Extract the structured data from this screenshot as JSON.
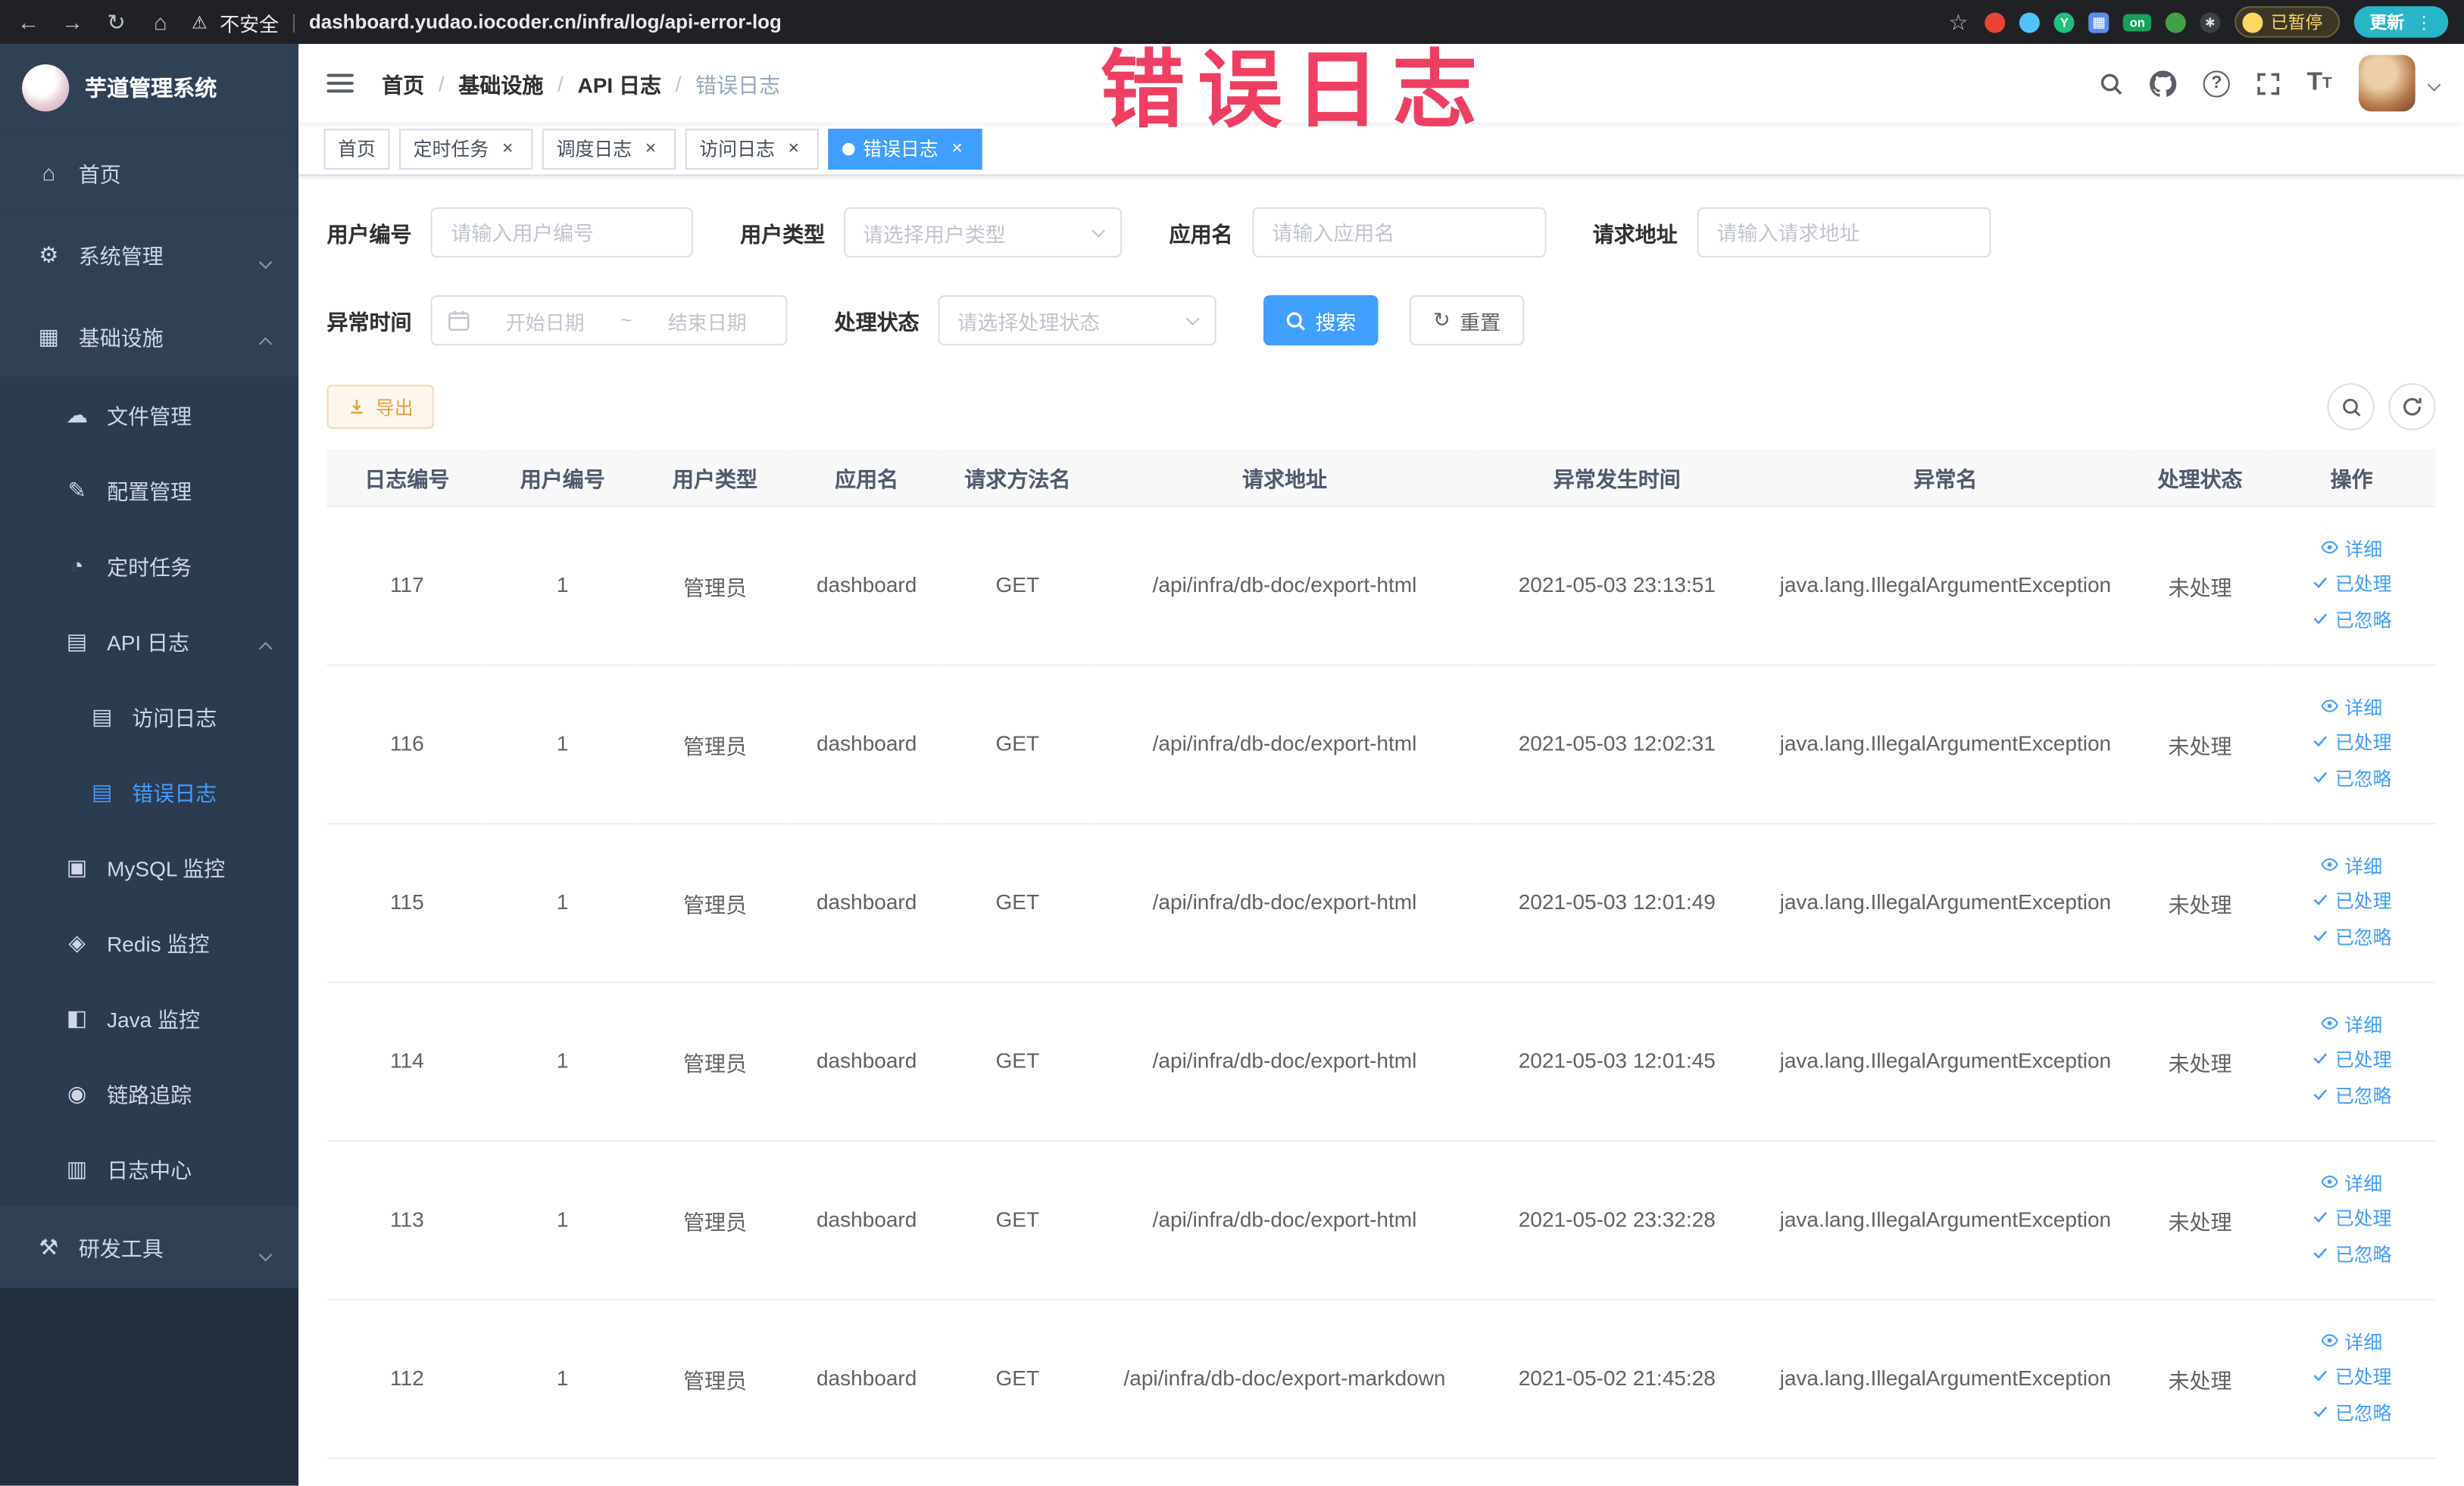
{
  "browser": {
    "insecure_label": "不安全",
    "url": "dashboard.yudao.iocoder.cn/infra/log/api-error-log",
    "extension_badge": "on",
    "extension_letter": "Y",
    "paused_button": "已暂停",
    "update_button": "更新"
  },
  "annotation": "错误日志",
  "sidebar": {
    "logo_title": "芋道管理系统",
    "items": [
      {
        "id": "home",
        "label": "首页",
        "icon": "home-icon",
        "level": 1
      },
      {
        "id": "system",
        "label": "系统管理",
        "icon": "gear-icon",
        "level": 1,
        "arrow": "down"
      },
      {
        "id": "infra",
        "label": "基础设施",
        "icon": "grid-icon",
        "level": 1,
        "arrow": "up"
      },
      {
        "id": "file",
        "label": "文件管理",
        "icon": "cloud-icon",
        "level": 2
      },
      {
        "id": "config",
        "label": "配置管理",
        "icon": "edit-icon",
        "level": 2
      },
      {
        "id": "job",
        "label": "定时任务",
        "icon": "clock-icon",
        "level": 2
      },
      {
        "id": "api-log",
        "label": "API 日志",
        "icon": "document-icon",
        "level": 2,
        "arrow": "up"
      },
      {
        "id": "access-log",
        "label": "访问日志",
        "icon": "document-icon",
        "level": 3
      },
      {
        "id": "error-log",
        "label": "错误日志",
        "icon": "document-icon",
        "level": 3,
        "active": true
      },
      {
        "id": "mysql",
        "label": "MySQL 监控",
        "icon": "database-icon",
        "level": 2
      },
      {
        "id": "redis",
        "label": "Redis 监控",
        "icon": "redis-icon",
        "level": 2
      },
      {
        "id": "java",
        "label": "Java 监控",
        "icon": "monitor-icon",
        "level": 2
      },
      {
        "id": "trace",
        "label": "链路追踪",
        "icon": "eye-icon",
        "level": 2
      },
      {
        "id": "log-center",
        "label": "日志中心",
        "icon": "log-icon",
        "level": 2
      },
      {
        "id": "devtools",
        "label": "研发工具",
        "icon": "tools-icon",
        "level": 1,
        "arrow": "down"
      }
    ]
  },
  "navbar": {
    "breadcrumb": [
      "首页",
      "基础设施",
      "API 日志",
      "错误日志"
    ]
  },
  "tabs": [
    {
      "id": "home",
      "label": "首页",
      "closable": false,
      "active": false
    },
    {
      "id": "cron-job",
      "label": "定时任务",
      "closable": true,
      "active": false
    },
    {
      "id": "job-log",
      "label": "调度日志",
      "closable": true,
      "active": false
    },
    {
      "id": "access-log",
      "label": "访问日志",
      "closable": true,
      "active": false
    },
    {
      "id": "error-log",
      "label": "错误日志",
      "closable": true,
      "active": true
    }
  ],
  "filters": {
    "user_id_label": "用户编号",
    "user_id_placeholder": "请输入用户编号",
    "user_type_label": "用户类型",
    "user_type_placeholder": "请选择用户类型",
    "app_name_label": "应用名",
    "app_name_placeholder": "请输入应用名",
    "request_url_label": "请求地址",
    "request_url_placeholder": "请输入请求地址",
    "exception_time_label": "异常时间",
    "date_start_placeholder": "开始日期",
    "date_separator": "~",
    "date_end_placeholder": "结束日期",
    "process_status_label": "处理状态",
    "process_status_placeholder": "请选择处理状态",
    "search_button": "搜索",
    "reset_button": "重置"
  },
  "toolbar": {
    "export_button": "导出"
  },
  "table": {
    "columns": [
      "日志编号",
      "用户编号",
      "用户类型",
      "应用名",
      "请求方法名",
      "请求地址",
      "异常发生时间",
      "异常名",
      "处理状态",
      "操作"
    ],
    "action_labels": {
      "detail": "详细",
      "processed": "已处理",
      "ignore": "已忽略"
    },
    "rows": [
      {
        "log_id": "117",
        "user_id": "1",
        "user_type": "管理员",
        "app_name": "dashboard",
        "method": "GET",
        "request_url": "/api/infra/db-doc/export-html",
        "time": "2021-05-03 23:13:51",
        "exception": "java.lang.IllegalArgumentException",
        "status": "未处理"
      },
      {
        "log_id": "116",
        "user_id": "1",
        "user_type": "管理员",
        "app_name": "dashboard",
        "method": "GET",
        "request_url": "/api/infra/db-doc/export-html",
        "time": "2021-05-03 12:02:31",
        "exception": "java.lang.IllegalArgumentException",
        "status": "未处理"
      },
      {
        "log_id": "115",
        "user_id": "1",
        "user_type": "管理员",
        "app_name": "dashboard",
        "method": "GET",
        "request_url": "/api/infra/db-doc/export-html",
        "time": "2021-05-03 12:01:49",
        "exception": "java.lang.IllegalArgumentException",
        "status": "未处理"
      },
      {
        "log_id": "114",
        "user_id": "1",
        "user_type": "管理员",
        "app_name": "dashboard",
        "method": "GET",
        "request_url": "/api/infra/db-doc/export-html",
        "time": "2021-05-03 12:01:45",
        "exception": "java.lang.IllegalArgumentException",
        "status": "未处理"
      },
      {
        "log_id": "113",
        "user_id": "1",
        "user_type": "管理员",
        "app_name": "dashboard",
        "method": "GET",
        "request_url": "/api/infra/db-doc/export-html",
        "time": "2021-05-02 23:32:28",
        "exception": "java.lang.IllegalArgumentException",
        "status": "未处理"
      },
      {
        "log_id": "112",
        "user_id": "1",
        "user_type": "管理员",
        "app_name": "dashboard",
        "method": "GET",
        "request_url": "/api/infra/db-doc/export-markdown",
        "time": "2021-05-02 21:45:28",
        "exception": "java.lang.IllegalArgumentException",
        "status": "未处理"
      }
    ]
  }
}
